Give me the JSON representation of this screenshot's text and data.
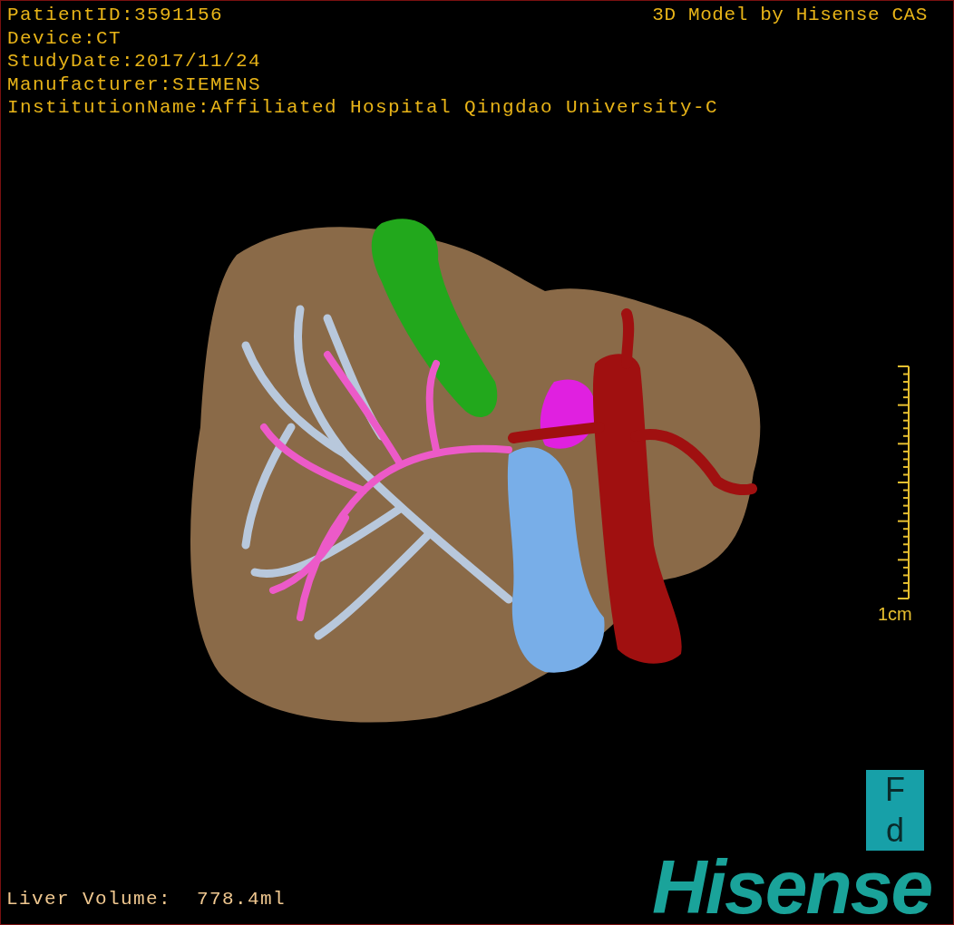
{
  "info_lines": [
    "PatientID:3591156",
    "Device:CT",
    "StudyDate:2017/11/24",
    "Manufacturer:SIEMENS",
    "InstitutionName:Affiliated Hospital Qingdao University-C"
  ],
  "credit": "3D Model by Hisense CAS",
  "scale_bar": {
    "label": "1cm"
  },
  "measurement": "Liver Volume:  778.4ml",
  "logo": {
    "letters": [
      "F",
      "d"
    ],
    "wordmark": "Hisense"
  }
}
